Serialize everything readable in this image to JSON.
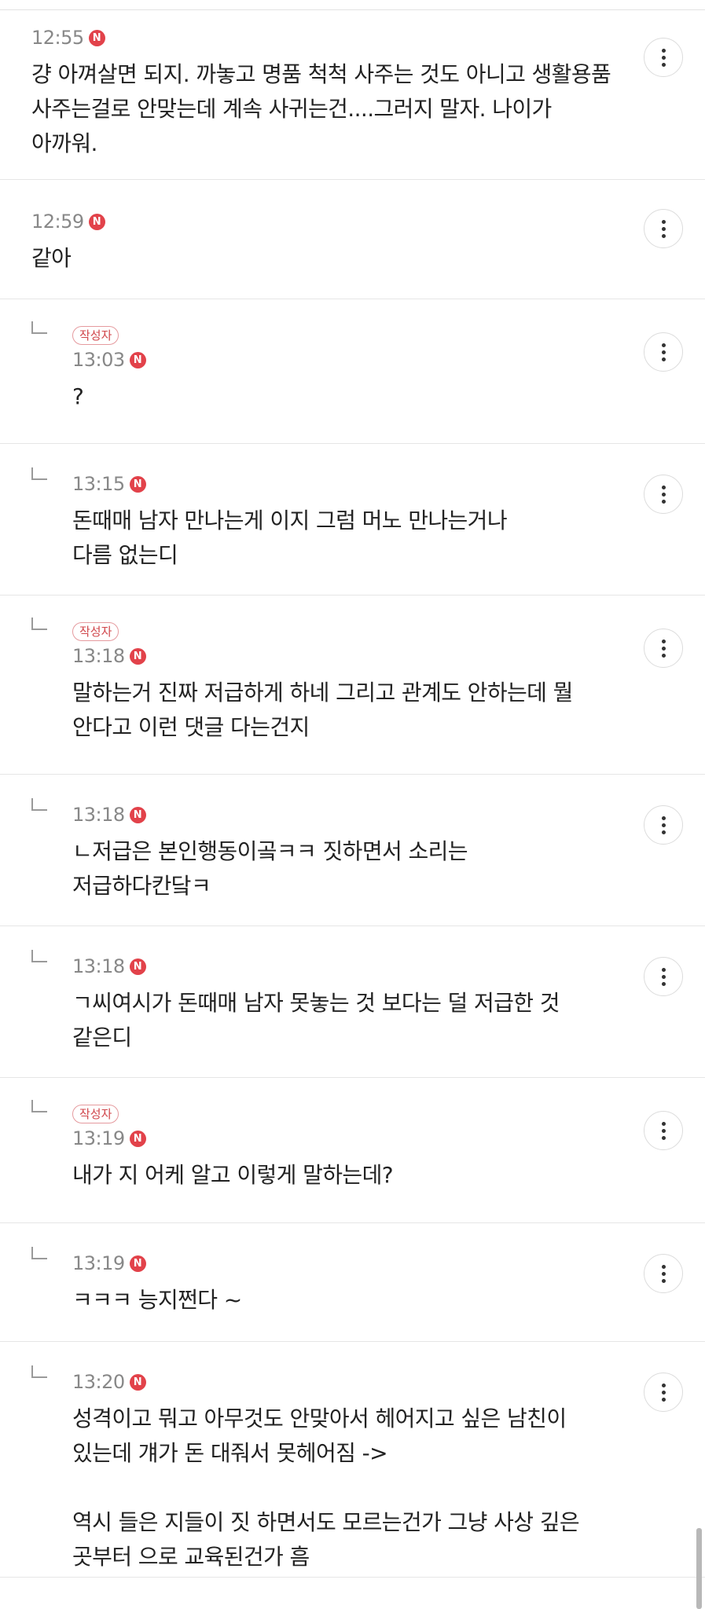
{
  "comments": [
    {
      "reply": false,
      "author": "",
      "time": "12:55",
      "badge": "N",
      "text": "걍 아껴살면 되지. 까놓고 명품 척척 사주는 것도 아니고 생활용품\n사주는걸로 안맞는데 계속 사귀는건....그러지 말자. 나이가\n아까워."
    },
    {
      "reply": false,
      "author": "",
      "time": "12:59",
      "badge": "N",
      "text": "같아"
    },
    {
      "reply": true,
      "author": "작성자",
      "time": "13:03",
      "badge": "N",
      "text": "?"
    },
    {
      "reply": true,
      "author": "",
      "time": "13:15",
      "badge": "N",
      "text": "돈때매 남자 만나는게 이지 그럼 머노 만나는거나\n다름 없는디"
    },
    {
      "reply": true,
      "author": "작성자",
      "time": "13:18",
      "badge": "N",
      "text": "말하는거 진짜 저급하게 하네 그리고 관계도 안하는데 뭘\n안다고 이런 댓글 다는건지"
    },
    {
      "reply": true,
      "author": "",
      "time": "13:18",
      "badge": "N",
      "text": "ㄴ저급은 본인행동이곸ㅋㅋ 짓하면서 소리는\n저급하다칸닼ㅋ"
    },
    {
      "reply": true,
      "author": "",
      "time": "13:18",
      "badge": "N",
      "text": "ㄱ씨여시가 돈때매 남자 못놓는 것 보다는 덜 저급한 것\n같은디"
    },
    {
      "reply": true,
      "author": "작성자",
      "time": "13:19",
      "badge": "N",
      "text": "내가 지 어케 알고 이렇게 말하는데?"
    },
    {
      "reply": true,
      "author": "",
      "time": "13:19",
      "badge": "N",
      "text": "ㅋㅋㅋ 능지쩐다 ~"
    },
    {
      "reply": true,
      "author": "",
      "time": "13:20",
      "badge": "N",
      "text": "성격이고 뭐고 아무것도 안맞아서 헤어지고 싶은 남친이\n있는데 걔가 돈 대줘서 못헤어짐 ->\n\n역시 들은 지들이 짓 하면서도 모르는건가 그냥 사상 깊은\n곳부터 으로 교육된건가 흠"
    }
  ],
  "more_icon": "more-vertical-icon",
  "colors": {
    "new_badge": "#e2424a",
    "author_badge": "#d0454a",
    "time": "#888888"
  }
}
